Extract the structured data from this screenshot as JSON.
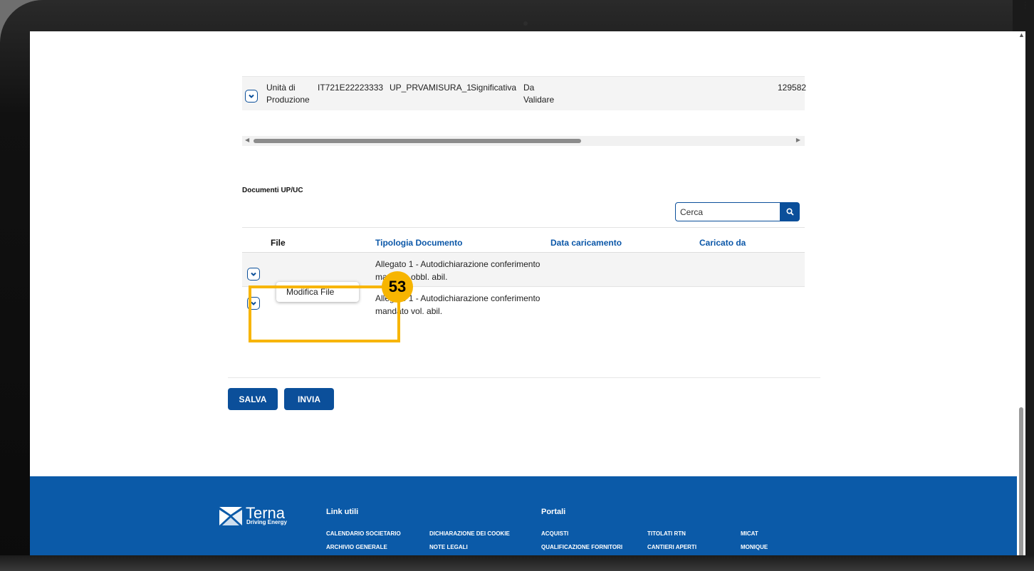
{
  "top_row": {
    "type_line1": "Unità di",
    "type_line2": "Produzione",
    "code": "IT721E22223333",
    "name": "UP_PRVAMISURA_1",
    "relevance": "Significativa",
    "status_line1": "Da",
    "status_line2": "Validare",
    "value": "129582"
  },
  "documents": {
    "section_title": "Documenti UP/UC",
    "search_placeholder": "Cerca",
    "columns": {
      "file": "File",
      "tipologia": "Tipologia Documento",
      "data": "Data caricamento",
      "caricato": "Caricato da"
    },
    "rows": [
      {
        "line1": "Allegato 1 - Autodichiarazione conferimento",
        "line2": "mandato obbl. abil."
      },
      {
        "line1": "Allegato 1 - Autodichiarazione conferimento",
        "line2": "mandato vol. abil."
      }
    ],
    "popup_item": "Modifica File"
  },
  "annotation": {
    "step_number": "53",
    "color": "#f7b500"
  },
  "actions": {
    "save": "SALVA",
    "send": "INVIA"
  },
  "footer": {
    "logo_name": "Terna",
    "logo_tagline": "Driving Energy",
    "link_utili_title": "Link utili",
    "portali_title": "Portali",
    "links": {
      "calendario": "CALENDARIO SOCIETARIO",
      "cookie": "DICHIARAZIONE DEI COOKIE",
      "archivio": "ARCHIVIO GENERALE",
      "note": "NOTE LEGALI",
      "acquisti": "ACQUISTI",
      "titolati": "TITOLATI RTN",
      "micat": "MICAT",
      "qualificazione": "QUALIFICAZIONE FORNITORI",
      "cantieri": "CANTIERI APERTI",
      "monique": "MONIQUE"
    }
  },
  "colors": {
    "primary": "#0b4f9a",
    "footer": "#0b5aa8",
    "link": "#0b57a8"
  }
}
